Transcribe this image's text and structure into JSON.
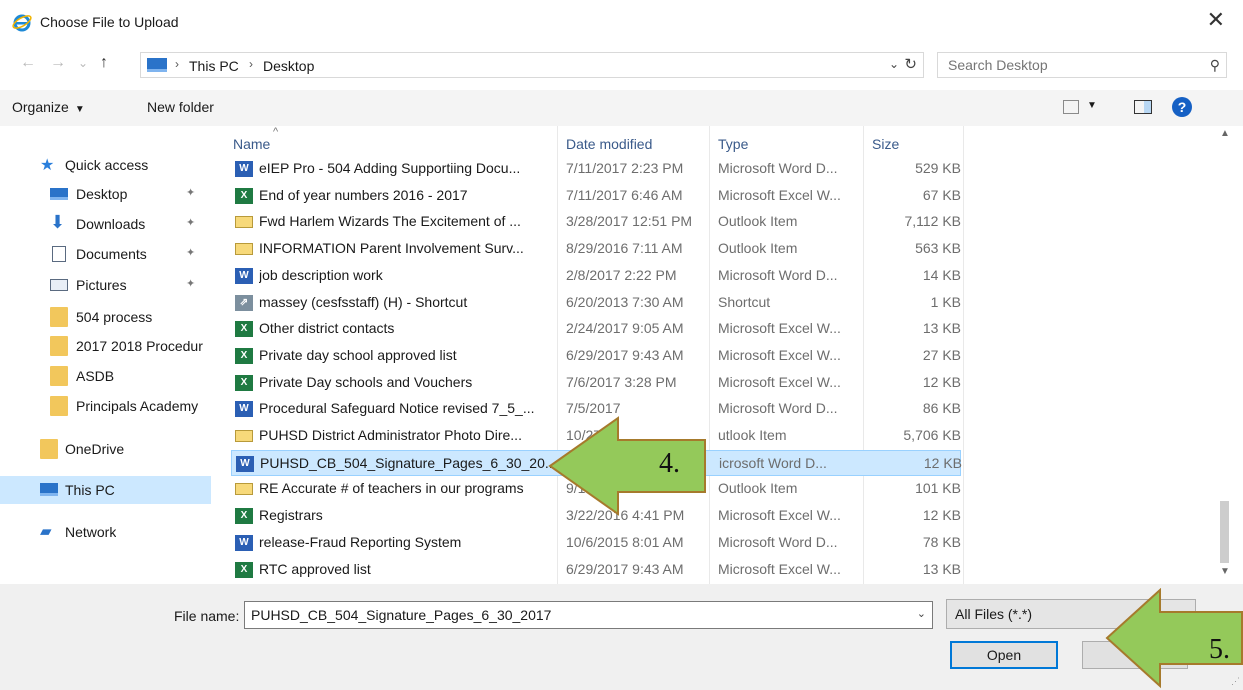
{
  "window": {
    "title": "Choose File to Upload",
    "close_glyph": "✕"
  },
  "address": {
    "back_glyph": "←",
    "forward_glyph": "→",
    "recent_glyph": "⌄",
    "up_glyph": "↑",
    "crumbs": [
      "This PC",
      "Desktop"
    ],
    "sep_glyph": "›",
    "dropdown_glyph": "⌄",
    "refresh_glyph": "↻",
    "search_placeholder": "Search Desktop",
    "search_glyph": "⚲"
  },
  "toolbar": {
    "organize_label": "Organize",
    "caret": "▼",
    "new_folder_label": "New folder",
    "help_glyph": "?"
  },
  "sidebar": {
    "items": [
      {
        "label": "Quick access",
        "icon": "star-icon"
      },
      {
        "label": "Desktop",
        "icon": "desktop-icon",
        "pinned": true
      },
      {
        "label": "Downloads",
        "icon": "download-icon",
        "pinned": true
      },
      {
        "label": "Documents",
        "icon": "document-icon",
        "pinned": true
      },
      {
        "label": "Pictures",
        "icon": "pictures-icon",
        "pinned": true
      },
      {
        "label": "504 process",
        "icon": "folder-icon"
      },
      {
        "label": "2017 2018 Procedur",
        "icon": "folder-icon"
      },
      {
        "label": "ASDB",
        "icon": "folder-icon"
      },
      {
        "label": "Principals Academy",
        "icon": "folder-icon"
      },
      {
        "label": "OneDrive",
        "icon": "folder-icon"
      },
      {
        "label": "This PC",
        "icon": "pc-icon"
      },
      {
        "label": "Network",
        "icon": "network-icon"
      }
    ],
    "pin_glyph": "📌"
  },
  "columns": {
    "name": "Name",
    "date": "Date modified",
    "type": "Type",
    "size": "Size",
    "sort_glyph": "^"
  },
  "files": [
    {
      "name": "eIEP Pro - 504 Adding Supportiing Docu...",
      "date": "7/11/2017 2:23 PM",
      "type": "Microsoft Word D...",
      "size": "529 KB",
      "kind": "word"
    },
    {
      "name": "End of year numbers  2016 - 2017",
      "date": "7/11/2017 6:46 AM",
      "type": "Microsoft Excel W...",
      "size": "67 KB",
      "kind": "excel"
    },
    {
      "name": "Fwd  Harlem Wizards The Excitement of ...",
      "date": "3/28/2017 12:51 PM",
      "type": "Outlook Item",
      "size": "7,112 KB",
      "kind": "mail"
    },
    {
      "name": "INFORMATION  Parent Involvement Surv...",
      "date": "8/29/2016 7:11 AM",
      "type": "Outlook Item",
      "size": "563 KB",
      "kind": "mail"
    },
    {
      "name": "job description work",
      "date": "2/8/2017 2:22 PM",
      "type": "Microsoft Word D...",
      "size": "14 KB",
      "kind": "word"
    },
    {
      "name": "massey (cesfsstaff) (H) - Shortcut",
      "date": "6/20/2013 7:30 AM",
      "type": "Shortcut",
      "size": "1 KB",
      "kind": "shortcut"
    },
    {
      "name": "Other district contacts",
      "date": "2/24/2017 9:05 AM",
      "type": "Microsoft Excel W...",
      "size": "13 KB",
      "kind": "excel"
    },
    {
      "name": "Private day school approved list",
      "date": "6/29/2017 9:43 AM",
      "type": "Microsoft Excel W...",
      "size": "27 KB",
      "kind": "excel"
    },
    {
      "name": "Private Day schools and Vouchers",
      "date": "7/6/2017 3:28 PM",
      "type": "Microsoft Excel W...",
      "size": "12 KB",
      "kind": "excel"
    },
    {
      "name": "Procedural Safeguard Notice revised 7_5_...",
      "date": "7/5/2017 ",
      "type": "Microsoft Word D...",
      "size": "86 KB",
      "kind": "word"
    },
    {
      "name": "PUHSD District Administrator Photo Dire...",
      "date": "10/27",
      "type": "utlook Item",
      "size": "5,706 KB",
      "kind": "mail"
    },
    {
      "name": "PUHSD_CB_504_Signature_Pages_6_30_20...",
      "date": "7/",
      "type": "icrosoft Word D...",
      "size": "12 KB",
      "kind": "word",
      "selected": true
    },
    {
      "name": "RE  Accurate # of teachers in our programs",
      "date": "9/14/20",
      "type": "Outlook Item",
      "size": "101 KB",
      "kind": "mail"
    },
    {
      "name": "Registrars",
      "date": "3/22/2016 4:41 PM",
      "type": "Microsoft Excel W...",
      "size": "12 KB",
      "kind": "excel"
    },
    {
      "name": "release-Fraud Reporting System",
      "date": "10/6/2015 8:01 AM",
      "type": "Microsoft Word D...",
      "size": "78 KB",
      "kind": "word"
    },
    {
      "name": "RTC approved list",
      "date": "6/29/2017 9:43 AM",
      "type": "Microsoft Excel W...",
      "size": "13 KB",
      "kind": "excel"
    }
  ],
  "file_icon_glyphs": {
    "word": "W",
    "excel": "X",
    "mail": "",
    "shortcut": "⇗"
  },
  "bottom": {
    "file_name_label": "File name:",
    "file_name_value": "PUHSD_CB_504_Signature_Pages_6_30_2017",
    "file_type_value": "All Files (*.*)",
    "dropdown_glyph": "⌄",
    "open_label": "Open",
    "cancel_label": "C",
    "grip_glyph": "⋰"
  },
  "annotations": {
    "step4": "4.",
    "step5": "5.",
    "arrow_color": "#94c95a",
    "arrow_border": "#a67a2c"
  },
  "colors": {
    "selection": "#cce8ff",
    "accent": "#0078d7",
    "toolbar_bg": "#f4f4f4",
    "footer_bg": "#f0f0f0"
  }
}
